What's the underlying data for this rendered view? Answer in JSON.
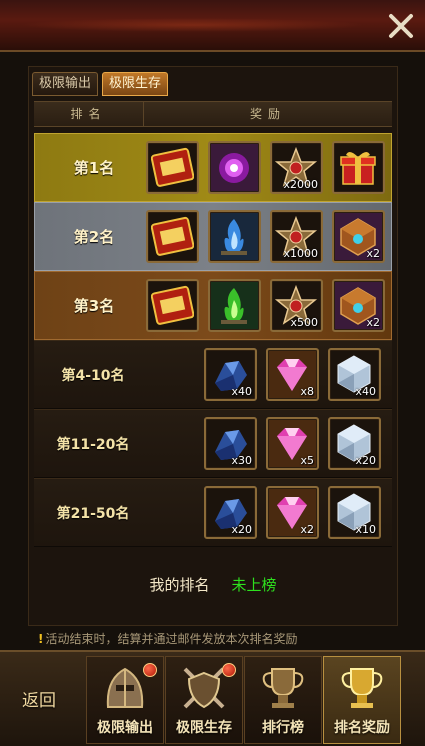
{
  "tabs": [
    {
      "label": "极限输出",
      "active": false
    },
    {
      "label": "极限生存",
      "active": true
    }
  ],
  "header": {
    "rank": "排名",
    "reward": "奖励"
  },
  "rows": [
    {
      "rank": "第1名",
      "style": "gold",
      "rewards": [
        {
          "icon": "title-badge-icon",
          "qty": ""
        },
        {
          "icon": "purple-orb-icon",
          "qty": ""
        },
        {
          "icon": "star-emblem-icon",
          "qty": "x2000"
        },
        {
          "icon": "gift-box-icon",
          "qty": ""
        }
      ]
    },
    {
      "rank": "第2名",
      "style": "silver",
      "rewards": [
        {
          "icon": "title-badge-icon",
          "qty": ""
        },
        {
          "icon": "blue-flame-icon",
          "qty": ""
        },
        {
          "icon": "star-emblem-icon",
          "qty": "x1000"
        },
        {
          "icon": "treasure-chest-icon",
          "qty": "x2"
        }
      ]
    },
    {
      "rank": "第3名",
      "style": "bronze",
      "rewards": [
        {
          "icon": "title-badge-icon",
          "qty": ""
        },
        {
          "icon": "green-flame-icon",
          "qty": ""
        },
        {
          "icon": "star-emblem-icon",
          "qty": "x500"
        },
        {
          "icon": "treasure-chest-icon",
          "qty": "x2"
        }
      ]
    },
    {
      "rank": "第4-10名",
      "style": "dark",
      "rewards": [
        {
          "icon": "blue-crystal-icon",
          "qty": "x40"
        },
        {
          "icon": "pink-gem-icon",
          "qty": "x8"
        },
        {
          "icon": "silver-gem-icon",
          "qty": "x40"
        }
      ]
    },
    {
      "rank": "第11-20名",
      "style": "dark",
      "rewards": [
        {
          "icon": "blue-crystal-icon",
          "qty": "x30"
        },
        {
          "icon": "pink-gem-icon",
          "qty": "x5"
        },
        {
          "icon": "silver-gem-icon",
          "qty": "x20"
        }
      ]
    },
    {
      "rank": "第21-50名",
      "style": "dark",
      "rewards": [
        {
          "icon": "blue-crystal-icon",
          "qty": "x20"
        },
        {
          "icon": "pink-gem-icon",
          "qty": "x2"
        },
        {
          "icon": "silver-gem-icon",
          "qty": "x10"
        }
      ]
    }
  ],
  "my_rank": {
    "label": "我的排名",
    "value": "未上榜"
  },
  "notice": "活动结束时，结算并通过邮件发放本次排名奖励",
  "bottom_nav": {
    "back": "返回",
    "items": [
      {
        "label": "极限输出",
        "icon": "warrior-helmet-icon",
        "badge": true,
        "active": false
      },
      {
        "label": "极限生存",
        "icon": "shield-crossed-swords-icon",
        "badge": true,
        "active": false
      },
      {
        "label": "排行榜",
        "icon": "trophy-cup-icon",
        "badge": false,
        "active": false
      },
      {
        "label": "排名奖励",
        "icon": "gold-trophy-icon",
        "badge": false,
        "active": true
      }
    ]
  },
  "colors": {
    "accent_green": "#2ee01e",
    "gold_row": "#a08a16",
    "silver_row": "#7c8188",
    "bronze_row": "#7c4a1a"
  }
}
